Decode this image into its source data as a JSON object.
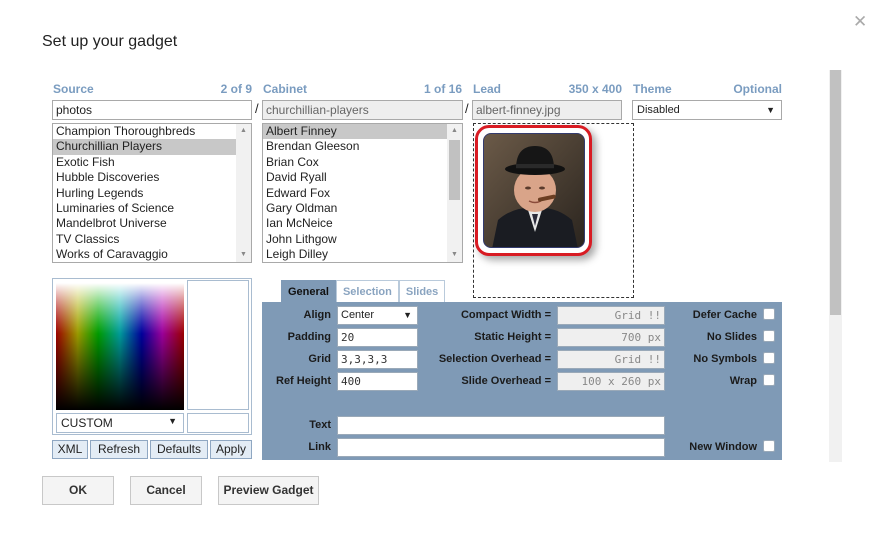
{
  "dialog": {
    "title": "Set up your gadget",
    "close_glyph": "✕"
  },
  "source": {
    "label": "Source",
    "count": "2 of 9",
    "value": "photos",
    "items": [
      "Champion Thoroughbreds",
      "Churchillian Players",
      "Exotic Fish",
      "Hubble Discoveries",
      "Hurling Legends",
      "Luminaries of Science",
      "Mandelbrot Universe",
      "TV Classics",
      "Works of Caravaggio"
    ],
    "selected_index": 1
  },
  "cabinet": {
    "label": "Cabinet",
    "count": "1 of 16",
    "value": "churchillian-players",
    "items": [
      "Albert Finney",
      "Brendan Gleeson",
      "Brian Cox",
      "David Ryall",
      "Edward Fox",
      "Gary Oldman",
      "Ian McNeice",
      "John Lithgow",
      "Leigh Dilley"
    ],
    "selected_index": 0
  },
  "lead": {
    "label": "Lead",
    "size": "350 x 400",
    "value": "albert-finney.jpg"
  },
  "theme": {
    "label": "Theme",
    "optional": "Optional",
    "value": "Disabled"
  },
  "separator": "/",
  "color_picker": {
    "mode": "CUSTOM"
  },
  "picker_buttons": {
    "xml": "XML",
    "refresh": "Refresh",
    "defaults": "Defaults",
    "apply": "Apply"
  },
  "tabs": [
    "General",
    "Selection",
    "Slides"
  ],
  "general": {
    "align_label": "Align",
    "align_value": "Center",
    "padding_label": "Padding",
    "padding_value": "20",
    "grid_label": "Grid",
    "grid_value": "3,3,3,3",
    "refheight_label": "Ref Height",
    "refheight_value": "400",
    "compact_width_label": "Compact Width =",
    "compact_width_value": "Grid !!",
    "static_height_label": "Static Height =",
    "static_height_value": "700 px",
    "selection_overhead_label": "Selection Overhead =",
    "selection_overhead_value": "Grid !!",
    "slide_overhead_label": "Slide Overhead =",
    "slide_overhead_value": "100 x 260 px",
    "defer_cache_label": "Defer Cache",
    "no_slides_label": "No Slides",
    "no_symbols_label": "No Symbols",
    "wrap_label": "Wrap",
    "text_label": "Text",
    "text_value": "",
    "link_label": "Link",
    "link_value": "",
    "new_window_label": "New Window"
  },
  "footer": {
    "ok": "OK",
    "cancel": "Cancel",
    "preview": "Preview Gadget"
  },
  "colors": {
    "accent": "#7f9ab6",
    "header": "#7a9cc0",
    "frame": "#d81b23"
  }
}
